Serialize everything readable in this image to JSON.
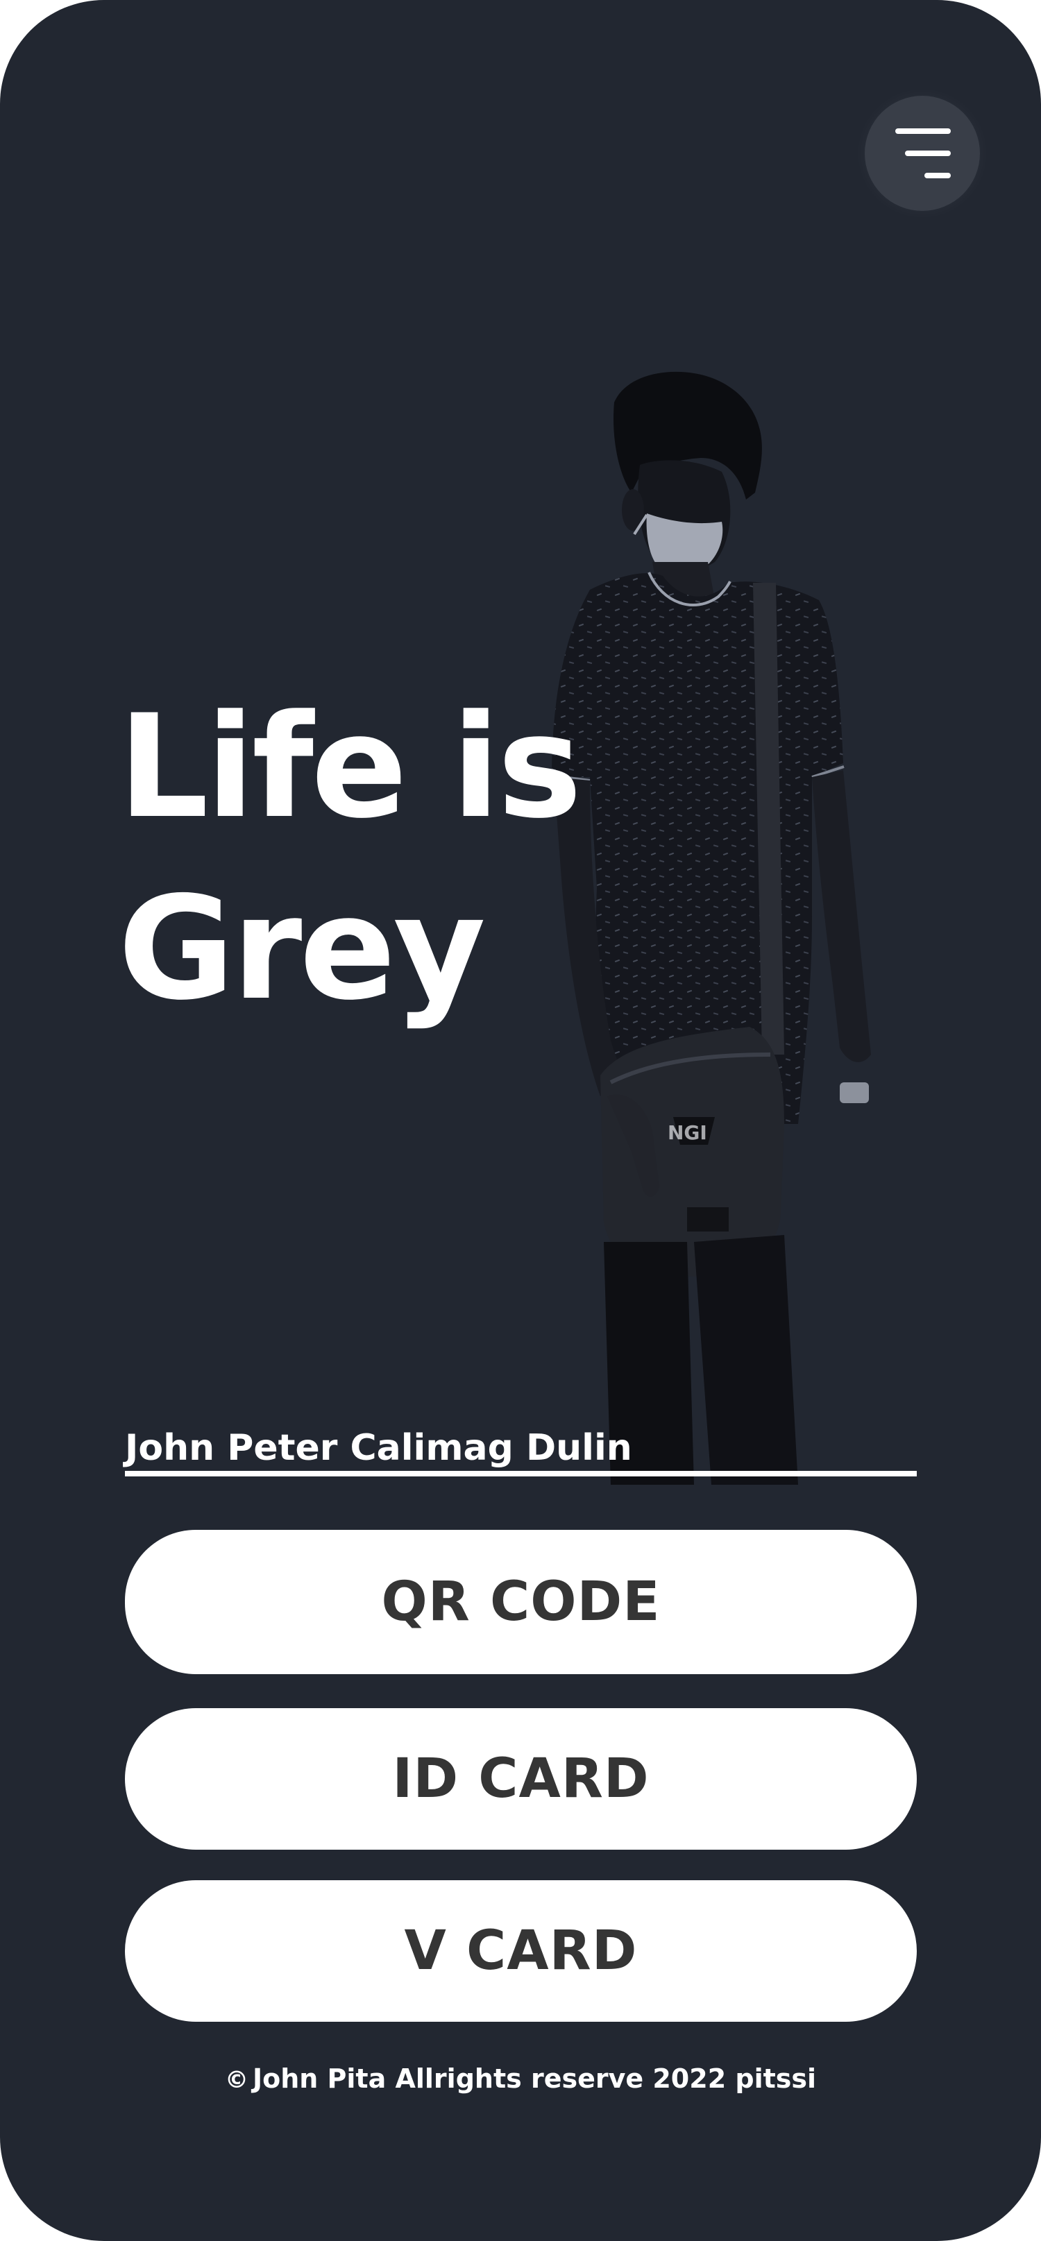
{
  "hero": {
    "line1": "Life is",
    "line2": "Grey"
  },
  "owner": {
    "name": "John Peter Calimag Dulin"
  },
  "actions": {
    "qr_label": "QR CODE",
    "id_label": "ID CARD",
    "vcard_label": "V CARD"
  },
  "footer": {
    "copyright_symbol": "©",
    "text": "John Pita  Allrights reserve 2022 pitssi"
  },
  "icons": {
    "menu": "menu-lines-icon",
    "photo": "person-photo"
  },
  "colors": {
    "background": "#222731",
    "menu_button": "#393e48",
    "button_bg": "#ffffff",
    "button_text": "#353535",
    "text": "#ffffff"
  }
}
